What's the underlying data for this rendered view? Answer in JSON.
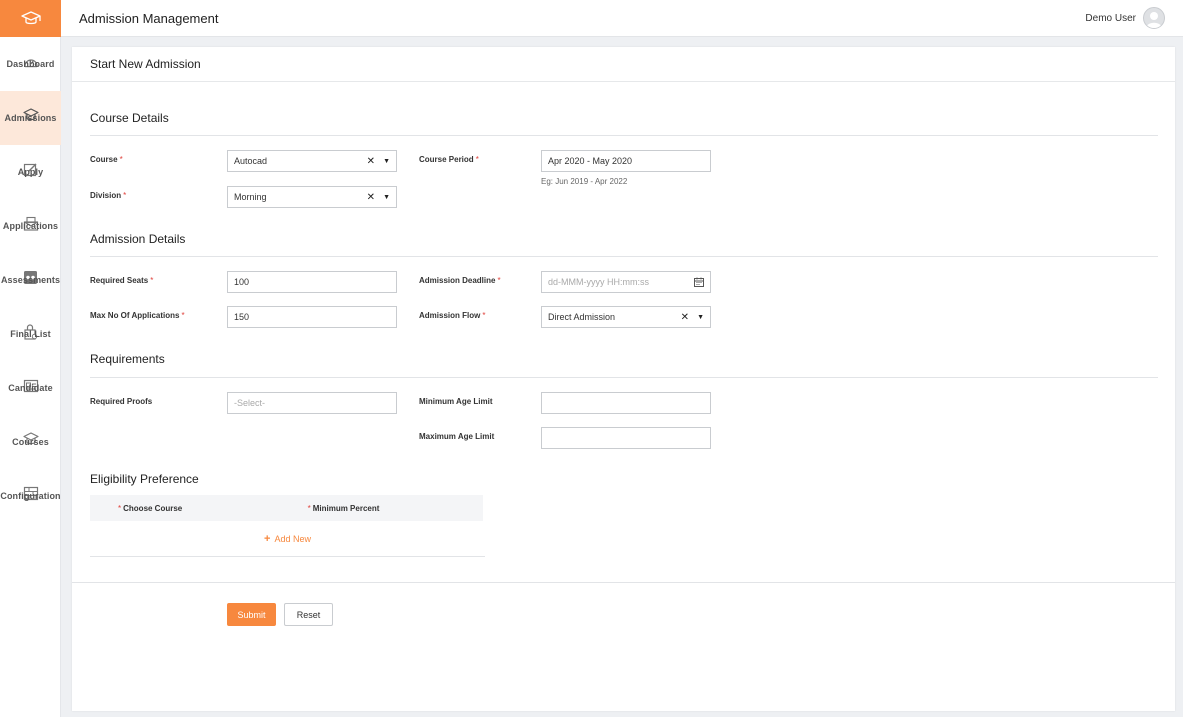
{
  "header": {
    "title": "Admission Management",
    "user_name": "Demo User"
  },
  "sidebar": {
    "items": [
      {
        "label": "Dashboard",
        "icon": "dashboard-icon"
      },
      {
        "label": "Admissions",
        "icon": "graduation-cap-icon",
        "active": true
      },
      {
        "label": "Apply",
        "icon": "edit-icon"
      },
      {
        "label": "Applications",
        "icon": "inbox-icon"
      },
      {
        "label": "Assessments",
        "icon": "assessment-icon"
      },
      {
        "label": "Final List",
        "icon": "lock-list-icon"
      },
      {
        "label": "Candidate",
        "icon": "id-card-icon"
      },
      {
        "label": "Courses",
        "icon": "graduation-cap-icon"
      },
      {
        "label": "Configuration",
        "icon": "config-icon"
      }
    ]
  },
  "page": {
    "title": "Start New Admission"
  },
  "course_details": {
    "heading": "Course Details",
    "course_label": "Course",
    "course_value": "Autocad",
    "division_label": "Division",
    "division_value": "Morning",
    "period_label": "Course Period",
    "period_value": "Apr 2020 - May 2020",
    "period_hint": "Eg: Jun 2019 - Apr 2022"
  },
  "admission_details": {
    "heading": "Admission Details",
    "seats_label": "Required Seats",
    "seats_value": "100",
    "max_apps_label": "Max No Of Applications",
    "max_apps_value": "150",
    "deadline_label": "Admission Deadline",
    "deadline_placeholder": "dd-MMM-yyyy HH:mm:ss",
    "flow_label": "Admission Flow",
    "flow_value": "Direct Admission"
  },
  "requirements": {
    "heading": "Requirements",
    "proofs_label": "Required Proofs",
    "proofs_placeholder": "-Select-",
    "min_age_label": "Minimum Age Limit",
    "min_age_value": "",
    "max_age_label": "Maximum Age Limit",
    "max_age_value": ""
  },
  "eligibility": {
    "heading": "Eligibility Preference",
    "columns": [
      "Choose Course",
      "Minimum Percent"
    ],
    "add_new_label": "Add New"
  },
  "actions": {
    "submit_label": "Submit",
    "reset_label": "Reset"
  },
  "colors": {
    "accent": "#f7883e",
    "active_bg": "#fde8da",
    "required": "#e0413b"
  }
}
